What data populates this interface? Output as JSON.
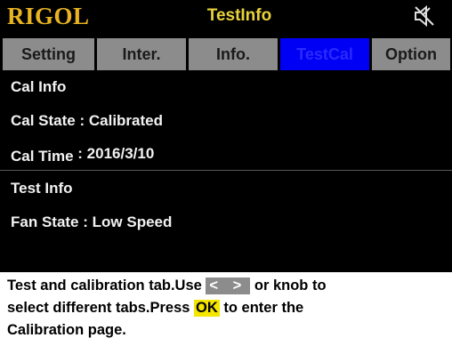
{
  "titlebar": {
    "logo": "RIGOL",
    "title": "TestInfo",
    "status_icon": "speaker-muted-icon"
  },
  "tabs": [
    {
      "label": "Setting",
      "active": false
    },
    {
      "label": "Inter.",
      "active": false
    },
    {
      "label": "Info.",
      "active": false
    },
    {
      "label": "TestCal",
      "active": true
    },
    {
      "label": "Option",
      "active": false
    }
  ],
  "cal_section": {
    "heading": "Cal Info",
    "state_label": "Cal State",
    "state_value": ": Calibrated",
    "time_label": "Cal Time",
    "time_value": ": 2016/3/10"
  },
  "test_section": {
    "heading": "Test Info",
    "fan_label": "Fan State",
    "fan_value": ": Low Speed"
  },
  "help": {
    "line1_pre": "Test and calibration tab.Use",
    "arrow_keys": "< >",
    "line1_post": "or knob to",
    "line2_pre": "select different tabs.Press",
    "ok_key": "OK",
    "line2_post": "to enter the",
    "line3": "Calibration page."
  },
  "colors": {
    "logo": "#e8b422",
    "title": "#e8d23a",
    "tab_inactive": "#8c8c8c",
    "tab_active": "#0000f5",
    "ok_key_bg": "#f5e600"
  }
}
